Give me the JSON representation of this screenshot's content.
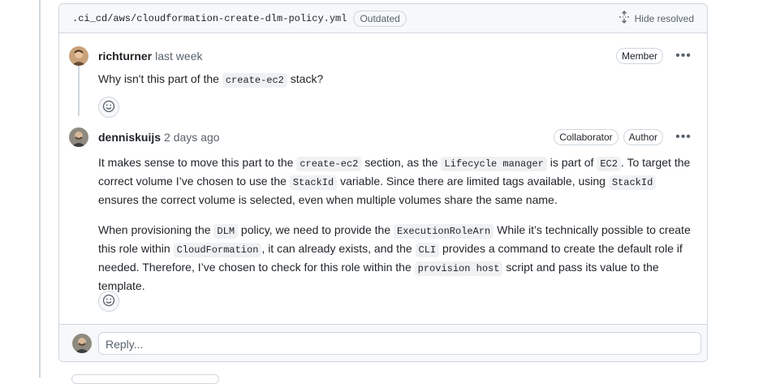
{
  "file": {
    "path": ".ci_cd/aws/cloudformation-create-dlm-policy.yml",
    "status_badge": "Outdated",
    "hide_resolved_label": "Hide resolved"
  },
  "comments": [
    {
      "author": "richturner",
      "time": "last week",
      "badges": [
        "Member"
      ],
      "body": {
        "before": "Why isn't this part of the ",
        "code": "create-ec2",
        "after": " stack?"
      }
    },
    {
      "author": "denniskuijs",
      "time": "2 days ago",
      "badges": [
        "Collaborator",
        "Author"
      ],
      "para1": {
        "t1": "It makes sense to move this part to the ",
        "c1": "create-ec2",
        "t2": " section, as the ",
        "c2": "Lifecycle manager",
        "t3": " is part of ",
        "c3": "EC2",
        "t4": ". To target the correct volume I’ve chosen to use the ",
        "c4": "StackId",
        "t5": " variable. Since there are limited tags available, using ",
        "c5": "StackId",
        "t6": " ensures the correct volume is selected, even when multiple volumes share the same name."
      },
      "para2": {
        "t1": "When provisioning the ",
        "c1": "DLM",
        "t2": " policy, we need to provide the ",
        "c2": "ExecutionRoleArn",
        "t3": " While it’s technically possible to create this role within ",
        "c3": "CloudFormation",
        "t4": ", it can already exists, and the ",
        "c4": "CLI",
        "t5": " provides a command to create the default role if needed. Therefore, I’ve chosen to check for this role within the ",
        "c5": "provision host",
        "t6": " script and pass its value to the template."
      }
    }
  ],
  "reply": {
    "placeholder": "Reply..."
  },
  "icons": {
    "unfold": "unfold-icon",
    "smiley": "smiley-icon",
    "kebab": "kebab-horizontal-icon"
  }
}
